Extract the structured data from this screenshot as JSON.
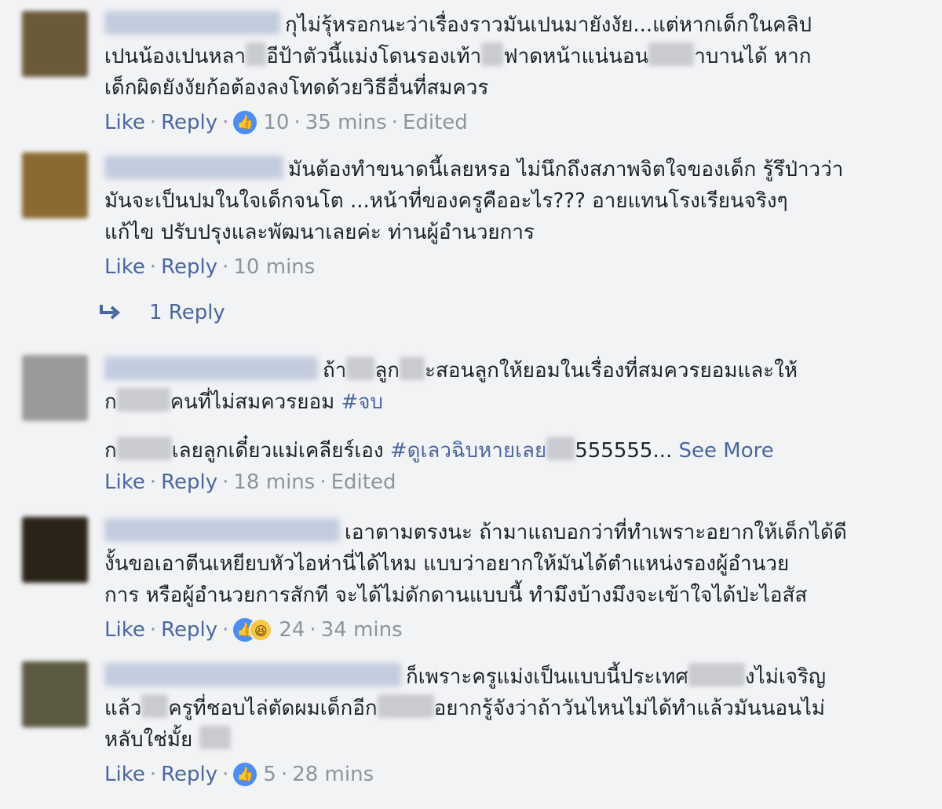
{
  "comments": [
    {
      "avatar_color": "#6b5a3a",
      "line1": "กุไม่รุ้หรอกนะว่าเรื่องราวมันเปนมายังงัย...แต่หากเด็กในคลิป",
      "line2a": "เปนน้องเปนหลา",
      "line2b": "อีป้าตัวนี้แม่งโดนรองเท้า",
      "line2c": "ฟาดหน้าแน่นอน",
      "line2d": "าบานได้ หาก",
      "line3": "เด็กผิดยังงัยก้อต้องลงโทดด้วยวิธีอื่นที่สมควร",
      "like": "Like",
      "reply": "Reply",
      "reactions": "10",
      "time": "35 mins",
      "edited": "Edited"
    },
    {
      "avatar_color": "#8a6a30",
      "line1": "มันต้องทำขนาดนี้เลยหรอ ไม่นึกถึงสภาพจิตใจของเด็ก รู้รึป่าวว่า",
      "line2": "มันจะเป็นปมในใจเด็กจนโต ...หน้าที่ของครูคืออะไร??? อายแทนโรงเรียนจริงๆ",
      "line3": "แก้ไข ปรับปรุงและพัฒนาเลยค่ะ ท่านผู้อำนวยการ",
      "like": "Like",
      "reply": "Reply",
      "time": "10 mins",
      "replies_label": "1 Reply"
    },
    {
      "avatar_color": "#9a9a9a",
      "line1a": "ถ้า",
      "line1b": "ลูก",
      "line1c": "ะสอนลูกให้ยอมในเรื่องที่สมควรยอมและให้",
      "line2a": "ก",
      "line2b": "คนที่ไม่สมควรยอม",
      "hashtag1": "#จบ",
      "line3a": "ก",
      "line3b": "เลยลูกเดี๋ยวแม่เคลียร์เอง",
      "hashtag2": "#ดูเลวฉิบหายเลย",
      "line3c": "555555...",
      "see_more": "See More",
      "like": "Like",
      "reply": "Reply",
      "time": "18 mins",
      "edited": "Edited"
    },
    {
      "avatar_color": "#2a2418",
      "line1": "เอาตามตรงนะ ถ้ามาแถบอกว่าที่ทำเพราะอยากให้เด็กได้ดี",
      "line2": "งั้นขอเอาตีนเหยียบหัวไอห่านี่ได้ไหม แบบว่าอยากให้มันได้ตำแหน่งรองผู้อำนวย",
      "line3": "การ หรือผู้อำนวยการสักที จะได้ไม่ดักดานแบบนี้ ทำมึงบ้างมึงจะเข้าใจได้ป่ะไอสัส",
      "like": "Like",
      "reply": "Reply",
      "reactions": "24",
      "time": "34 mins"
    },
    {
      "avatar_color": "#5d5a44",
      "line1a": "ก็เพราะครูแม่งเป็นแบบนี้ประเทศ",
      "line1b": "งไม่เจริญ",
      "line2a": "แล้ว",
      "line2b": "ครูที่ชอบไล่ตัดผมเด็กอีก",
      "line2c": "อยากรู้จังว่าถ้าวันไหนไม่ได้ทำแล้วมันนอนไม่",
      "line3": "หลับใช่มั้ย",
      "like": "Like",
      "reply": "Reply",
      "reactions": "5",
      "time": "28 mins"
    }
  ]
}
